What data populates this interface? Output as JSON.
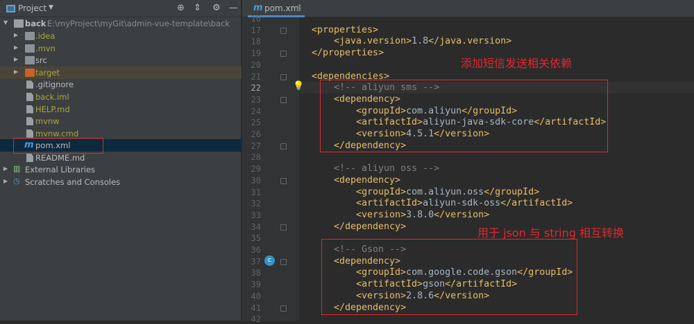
{
  "project_panel": {
    "title": "Project",
    "root": {
      "name": "back",
      "path": "E:\\myProject\\myGit\\admin-vue-template\\back"
    },
    "items": [
      {
        "label": ".idea",
        "type": "folder",
        "color": "yellow"
      },
      {
        "label": ".mvn",
        "type": "folder",
        "color": "yellow"
      },
      {
        "label": "src",
        "type": "folder",
        "color": "default"
      },
      {
        "label": "target",
        "type": "folder-excluded",
        "color": "yellow"
      },
      {
        "label": ".gitignore",
        "type": "file",
        "color": "default"
      },
      {
        "label": "back.iml",
        "type": "file",
        "color": "yellow"
      },
      {
        "label": "HELP.md",
        "type": "markdown",
        "color": "yellow"
      },
      {
        "label": "mvnw",
        "type": "shell",
        "color": "yellow"
      },
      {
        "label": "mvnw.cmd",
        "type": "file",
        "color": "yellow"
      },
      {
        "label": "pom.xml",
        "type": "maven",
        "color": "default",
        "selected": true
      },
      {
        "label": "README.md",
        "type": "markdown",
        "color": "default"
      }
    ],
    "external": "External Libraries",
    "scratches": "Scratches and Consoles"
  },
  "editor": {
    "tab": {
      "icon": "m",
      "label": "pom.xml",
      "close": "×"
    },
    "current_line": 22,
    "lines": [
      {
        "n": 16,
        "i": 0,
        "t": ""
      },
      {
        "n": 17,
        "i": 1,
        "t": "<properties>"
      },
      {
        "n": 18,
        "i": 2,
        "t": "<java.version>1.8</java.version>"
      },
      {
        "n": 19,
        "i": 1,
        "t": "</properties>"
      },
      {
        "n": 20,
        "i": 0,
        "t": ""
      },
      {
        "n": 21,
        "i": 1,
        "t": "<dependencies>"
      },
      {
        "n": 22,
        "i": 2,
        "t": "<!-- aliyun sms -->"
      },
      {
        "n": 23,
        "i": 2,
        "t": "<dependency>"
      },
      {
        "n": 24,
        "i": 3,
        "t": "<groupId>com.aliyun</groupId>"
      },
      {
        "n": 25,
        "i": 3,
        "t": "<artifactId>aliyun-java-sdk-core</artifactId>"
      },
      {
        "n": 26,
        "i": 3,
        "t": "<version>4.5.1</version>"
      },
      {
        "n": 27,
        "i": 2,
        "t": "</dependency>"
      },
      {
        "n": 28,
        "i": 0,
        "t": ""
      },
      {
        "n": 29,
        "i": 2,
        "t": "<!-- aliyun oss -->"
      },
      {
        "n": 30,
        "i": 2,
        "t": "<dependency>"
      },
      {
        "n": 31,
        "i": 3,
        "t": "<groupId>com.aliyun.oss</groupId>"
      },
      {
        "n": 32,
        "i": 3,
        "t": "<artifactId>aliyun-sdk-oss</artifactId>"
      },
      {
        "n": 33,
        "i": 3,
        "t": "<version>3.8.0</version>"
      },
      {
        "n": 34,
        "i": 2,
        "t": "</dependency>"
      },
      {
        "n": 35,
        "i": 0,
        "t": ""
      },
      {
        "n": 36,
        "i": 2,
        "t": "<!-- Gson -->"
      },
      {
        "n": 37,
        "i": 2,
        "t": "<dependency>"
      },
      {
        "n": 38,
        "i": 3,
        "t": "<groupId>com.google.code.gson</groupId>"
      },
      {
        "n": 39,
        "i": 3,
        "t": "<artifactId>gson</artifactId>"
      },
      {
        "n": 40,
        "i": 3,
        "t": "<version>2.8.6</version>"
      },
      {
        "n": 41,
        "i": 2,
        "t": "</dependency>"
      },
      {
        "n": 42,
        "i": 0,
        "t": ""
      }
    ],
    "fold_lines": [
      17,
      19,
      21,
      23,
      27,
      30,
      34,
      37,
      41
    ]
  },
  "annotations": {
    "sms_note": "添加短信发送相关依赖",
    "gson_note": "用于 json 与 string 相互转换",
    "color": "#e0282e"
  },
  "colors": {
    "tag": "#e8bf6a",
    "text": "#a9b7c6",
    "comment": "#808080",
    "selection": "#0d293e"
  }
}
